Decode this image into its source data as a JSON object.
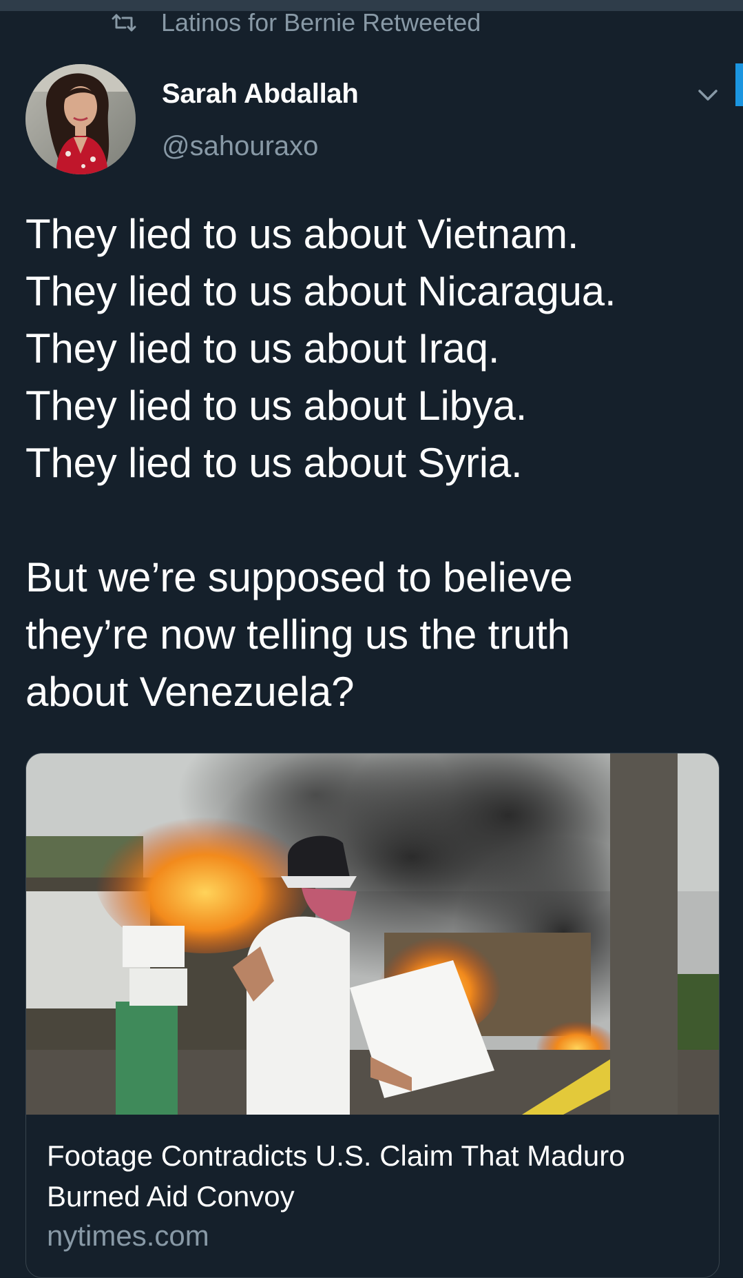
{
  "retweet_context": {
    "label": "Latinos for Bernie Retweeted",
    "icon": "retweet-icon"
  },
  "author": {
    "display_name": "Sarah Abdallah",
    "handle": "@sahouraxo",
    "avatar": "avatar-photo"
  },
  "menu": {
    "icon": "chevron-down-icon"
  },
  "tweet": {
    "lines": [
      "They lied to us about Vietnam.",
      "They lied to us about Nicaragua.",
      "They lied to us about Iraq.",
      "They lied to us about Libya.",
      "They lied to us about Syria.",
      "",
      "But we’re supposed to believe",
      "they’re now telling us the truth",
      "about Venezuela?"
    ]
  },
  "link_card": {
    "image": "burning-aid-convoy-photo",
    "title_lines": [
      "Footage Contradicts U.S. Claim That Maduro",
      "Burned Aid Convoy"
    ],
    "domain": "nytimes.com"
  },
  "colors": {
    "background": "#15202b",
    "secondary_text": "#8899a6",
    "border": "#38444d",
    "accent": "#1b95e0"
  }
}
